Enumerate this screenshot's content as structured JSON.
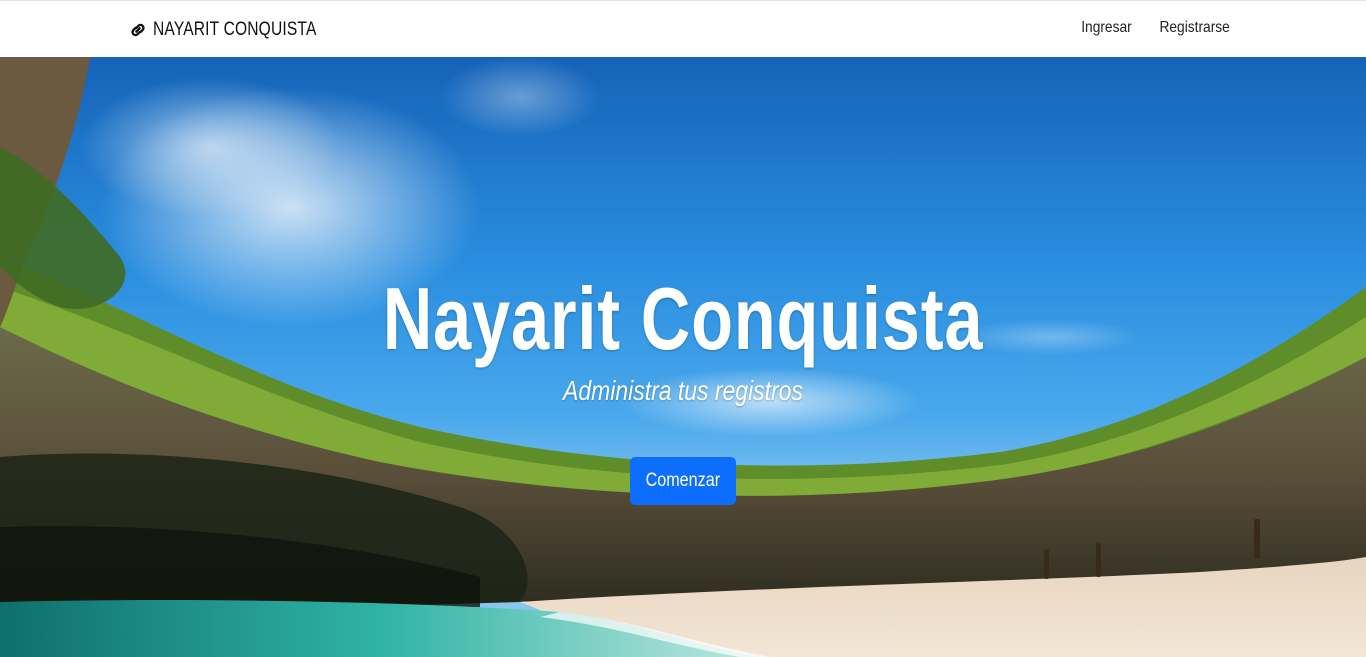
{
  "navbar": {
    "brand_icon": "link-icon",
    "brand_text": "NAYARIT CONQUISTA",
    "links": [
      {
        "label": "Ingresar"
      },
      {
        "label": "Registrarse"
      }
    ]
  },
  "hero": {
    "title": "Nayarit Conquista",
    "subtitle": "Administra tus registros",
    "cta_label": "Comenzar",
    "background": "beach-cave-photo"
  },
  "colors": {
    "primary": "#0d6efd",
    "sky": "#2b8fe0",
    "text_light": "#ffffff"
  }
}
